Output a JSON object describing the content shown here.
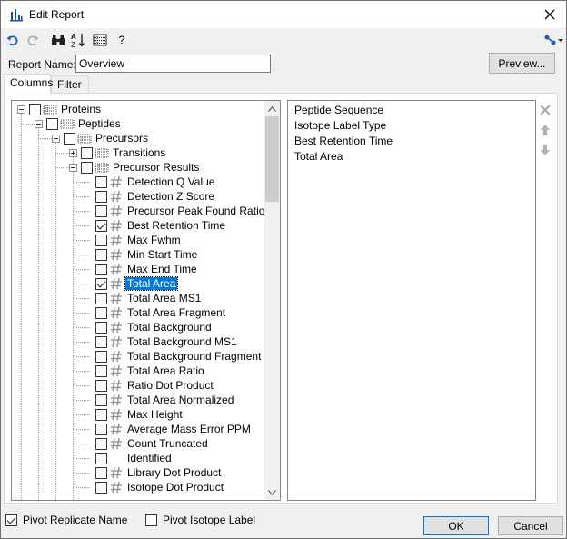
{
  "window": {
    "title": "Edit Report",
    "app_icon": "app-chart-icon",
    "close_icon": "close-icon"
  },
  "toolbar": {
    "items": [
      "undo-icon",
      "redo-icon",
      "find-binoculars-icon",
      "sort-az-icon",
      "grid-view-icon",
      "help-question-icon",
      "share-dropdown-icon"
    ],
    "help_label": "?"
  },
  "report_name": {
    "label": "Report Name:",
    "value": "Overview"
  },
  "preview_button": "Preview...",
  "tabs": [
    {
      "label": "Columns",
      "active": true
    },
    {
      "label": "Filter",
      "active": false
    }
  ],
  "tree": {
    "nodes": [
      {
        "label": "Proteins",
        "depth": 0,
        "expander": "minus",
        "checked": false,
        "icon": "table-icon",
        "selected": false
      },
      {
        "label": "Peptides",
        "depth": 1,
        "expander": "minus",
        "checked": false,
        "icon": "table-icon",
        "selected": false
      },
      {
        "label": "Precursors",
        "depth": 2,
        "expander": "minus",
        "checked": false,
        "icon": "table-icon",
        "selected": false
      },
      {
        "label": "Transitions",
        "depth": 3,
        "expander": "plus",
        "checked": false,
        "icon": "table-icon",
        "selected": false
      },
      {
        "label": "Precursor Results",
        "depth": 3,
        "expander": "minus",
        "checked": false,
        "icon": "table-icon",
        "selected": false
      },
      {
        "label": "Detection Q Value",
        "depth": 4,
        "expander": "",
        "checked": false,
        "icon": "hash-icon",
        "selected": false
      },
      {
        "label": "Detection Z Score",
        "depth": 4,
        "expander": "",
        "checked": false,
        "icon": "hash-icon",
        "selected": false
      },
      {
        "label": "Precursor Peak Found Ratio",
        "depth": 4,
        "expander": "",
        "checked": false,
        "icon": "hash-icon",
        "selected": false
      },
      {
        "label": "Best Retention Time",
        "depth": 4,
        "expander": "",
        "checked": true,
        "icon": "hash-icon",
        "selected": false
      },
      {
        "label": "Max Fwhm",
        "depth": 4,
        "expander": "",
        "checked": false,
        "icon": "hash-icon",
        "selected": false
      },
      {
        "label": "Min Start Time",
        "depth": 4,
        "expander": "",
        "checked": false,
        "icon": "hash-icon",
        "selected": false
      },
      {
        "label": "Max End Time",
        "depth": 4,
        "expander": "",
        "checked": false,
        "icon": "hash-icon",
        "selected": false
      },
      {
        "label": "Total Area",
        "depth": 4,
        "expander": "",
        "checked": true,
        "icon": "hash-icon",
        "selected": true
      },
      {
        "label": "Total Area MS1",
        "depth": 4,
        "expander": "",
        "checked": false,
        "icon": "hash-icon",
        "selected": false
      },
      {
        "label": "Total Area Fragment",
        "depth": 4,
        "expander": "",
        "checked": false,
        "icon": "hash-icon",
        "selected": false
      },
      {
        "label": "Total Background",
        "depth": 4,
        "expander": "",
        "checked": false,
        "icon": "hash-icon",
        "selected": false
      },
      {
        "label": "Total Background MS1",
        "depth": 4,
        "expander": "",
        "checked": false,
        "icon": "hash-icon",
        "selected": false
      },
      {
        "label": "Total Background Fragment",
        "depth": 4,
        "expander": "",
        "checked": false,
        "icon": "hash-icon",
        "selected": false
      },
      {
        "label": "Total Area Ratio",
        "depth": 4,
        "expander": "",
        "checked": false,
        "icon": "hash-icon",
        "selected": false
      },
      {
        "label": "Ratio Dot Product",
        "depth": 4,
        "expander": "",
        "checked": false,
        "icon": "hash-icon",
        "selected": false
      },
      {
        "label": "Total Area Normalized",
        "depth": 4,
        "expander": "",
        "checked": false,
        "icon": "hash-icon",
        "selected": false
      },
      {
        "label": "Max Height",
        "depth": 4,
        "expander": "",
        "checked": false,
        "icon": "hash-icon",
        "selected": false
      },
      {
        "label": "Average Mass Error PPM",
        "depth": 4,
        "expander": "",
        "checked": false,
        "icon": "hash-icon",
        "selected": false
      },
      {
        "label": "Count Truncated",
        "depth": 4,
        "expander": "",
        "checked": false,
        "icon": "hash-icon",
        "selected": false
      },
      {
        "label": "Identified",
        "depth": 4,
        "expander": "",
        "checked": false,
        "icon": "",
        "selected": false
      },
      {
        "label": "Library Dot Product",
        "depth": 4,
        "expander": "",
        "checked": false,
        "icon": "hash-icon",
        "selected": false
      },
      {
        "label": "Isotope Dot Product",
        "depth": 4,
        "expander": "",
        "checked": false,
        "icon": "hash-icon",
        "selected": false
      }
    ]
  },
  "selected_columns": [
    "Peptide Sequence",
    "Isotope Label Type",
    "Best Retention Time",
    "Total Area"
  ],
  "side_buttons": [
    "remove-x-icon",
    "move-up-icon",
    "move-down-icon"
  ],
  "options": {
    "pivot_replicate": {
      "label": "Pivot Replicate Name",
      "checked": true
    },
    "pivot_isotope": {
      "label": "Pivot Isotope Label",
      "checked": false
    }
  },
  "buttons": {
    "ok": "OK",
    "cancel": "Cancel"
  },
  "colors": {
    "selection": "#0078d7",
    "window_bg": "#f0f0f0",
    "border": "#828790"
  }
}
